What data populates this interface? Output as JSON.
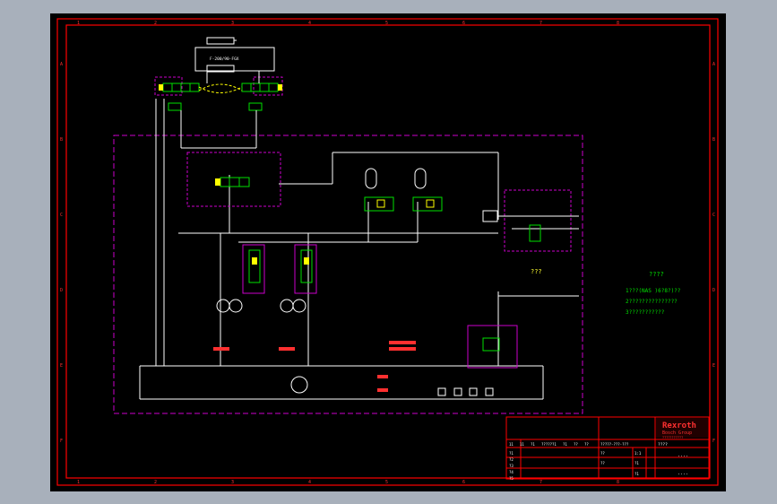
{
  "drawing": {
    "colors": {
      "background": "#000000",
      "frame": "#ff0000",
      "line": "#ffffff",
      "boundary": "#cc00cc",
      "component": "#00e000",
      "callout": "#ff8c00",
      "accent": "#ffff00",
      "app_surround": "#a8b0bb"
    },
    "border_columns": [
      "1",
      "2",
      "3",
      "4",
      "5",
      "6",
      "7",
      "8"
    ],
    "border_rows": [
      "A",
      "B",
      "C",
      "D",
      "E",
      "F"
    ],
    "cylinder_label": "F-200/90-FGX",
    "notes": {
      "center": "???",
      "right_title": "????",
      "right_line1": "1???(NAS )6?8?)??",
      "right_line2": "2???????????????",
      "right_line3": "3???????????"
    },
    "title_block": {
      "logo": "Rexroth",
      "logo_sub": "Bosch Group",
      "logo_small": "???????????",
      "rev_labels": [
        "11",
        "11",
        "?1",
        "?????",
        "?1",
        "?1",
        "??",
        "??"
      ],
      "row_labels": [
        "?1",
        "?2",
        "?3",
        "?4",
        "?5"
      ],
      "drawing_no": "?????-???-???",
      "scale_label": "????",
      "sheet_a": "1:1",
      "sheet_b": "?1",
      "sheet_c": "?1",
      "dots": "....",
      "sign_1": "??",
      "sign_2": "??"
    }
  }
}
